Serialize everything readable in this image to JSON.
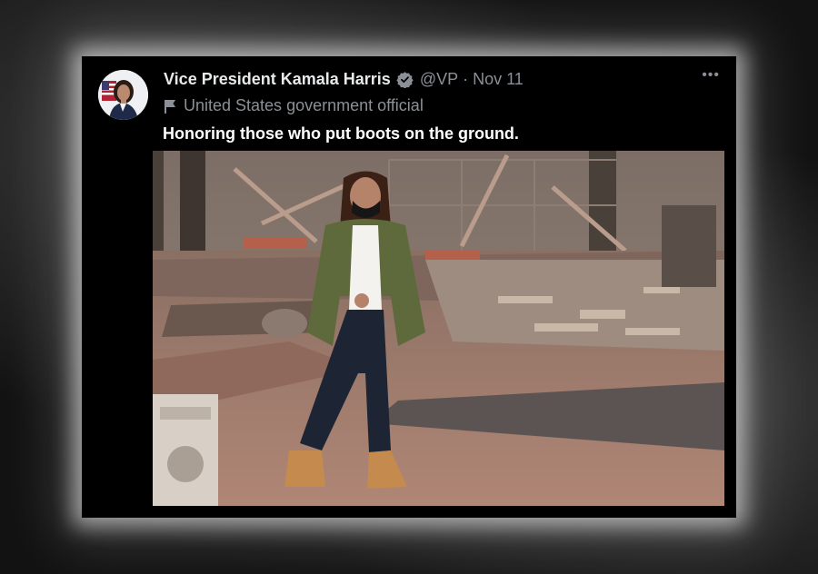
{
  "tweet": {
    "author_name": "Vice President Kamala Harris",
    "handle": "@VP",
    "separator": "·",
    "date": "Nov 11",
    "affiliation": "United States government official",
    "text": "Honoring those who put boots on the ground.",
    "more_label": "•••"
  },
  "icons": {
    "verified": "verified-badge-icon",
    "affiliation": "flag-icon",
    "more": "more-options-icon"
  },
  "colors": {
    "card_background": "#000000",
    "primary_text": "#e7e9ea",
    "secondary_text": "#8b9096",
    "glow": "#ffffff"
  }
}
